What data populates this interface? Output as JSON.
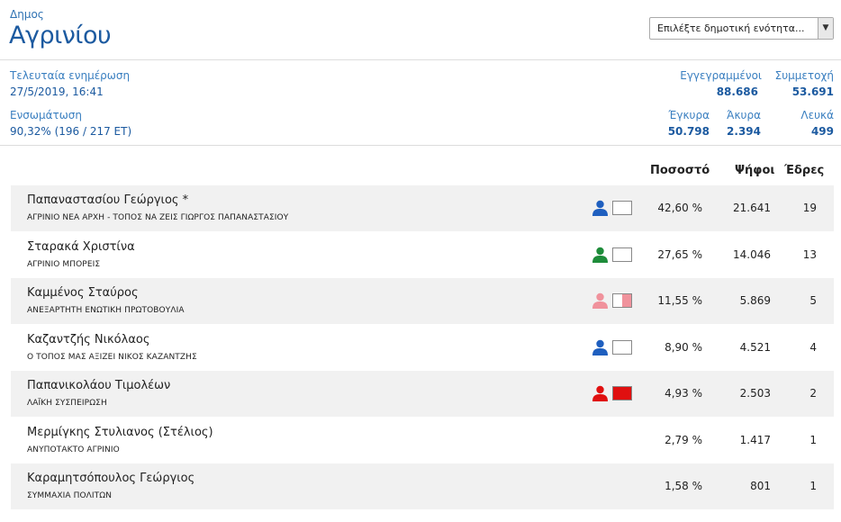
{
  "header": {
    "muni_label": "Δημος",
    "muni_name": "Αγρινίου",
    "select_placeholder": "Επιλέξτε δημοτική ενότητα..."
  },
  "stats": {
    "update_label": "Τελευταία ενημέρωση",
    "update_value": "27/5/2019, 16:41",
    "coverage_label": "Ενσωμάτωση",
    "coverage_value": "90,32% (196 / 217 ΕΤ)",
    "registered_label": "Εγγεγραμμένοι",
    "registered_value": "88.686",
    "turnout_label": "Συμμετοχή",
    "turnout_value": "53.691",
    "valid_label": "Έγκυρα",
    "valid_value": "50.798",
    "invalid_label": "Άκυρα",
    "invalid_value": "2.394",
    "blank_label": "Λευκά",
    "blank_value": "499"
  },
  "table": {
    "col_pct": "Ποσοστό",
    "col_votes": "Ψήφοι",
    "col_seats": "Έδρες",
    "rows": [
      {
        "name": "Παπαναστασίου Γεώργιος *",
        "party": "ΑΓΡΙΝΙΟ ΝΕΑ ΑΡΧΗ - ΤΟΠΟΣ ΝΑ ΖΕΙΣ ΓΙΩΡΓΟΣ ΠΑΠΑΝΑΣΤΑΣΙΟΥ",
        "pct": "42,60 %",
        "votes": "21.641",
        "seats": "19",
        "color": "#1f5fbf",
        "box_fill": 0.0,
        "box_color": "#ffffff",
        "icon": "person-icon"
      },
      {
        "name": "Σταρακά Χριστίνα",
        "party": "ΑΓΡΙΝΙΟ ΜΠΟΡΕΙΣ",
        "pct": "27,65 %",
        "votes": "14.046",
        "seats": "13",
        "color": "#1e8c3a",
        "box_fill": 0.0,
        "box_color": "#ffffff",
        "icon": "person-icon"
      },
      {
        "name": "Καμμένος Σταύρος",
        "party": "ΑΝΕΞΑΡΤΗΤΗ ΕΝΩΤΙΚΗ ΠΡΩΤΟΒΟΥΛΙΑ",
        "pct": "11,55 %",
        "votes": "5.869",
        "seats": "5",
        "color": "#f0929c",
        "box_fill": 0.5,
        "box_color": "#f0929c",
        "icon": "person-icon"
      },
      {
        "name": "Καζαντζής Νικόλαος",
        "party": "Ο ΤΟΠΟΣ ΜΑΣ ΑΞΙΖΕΙ ΝΙΚΟΣ ΚΑΖΑΝΤΖΗΣ",
        "pct": "8,90 %",
        "votes": "4.521",
        "seats": "4",
        "color": "#1f5fbf",
        "box_fill": 0.0,
        "box_color": "#ffffff",
        "icon": "person-icon"
      },
      {
        "name": "Παπανικολάου Τιμολέων",
        "party": "ΛΑΪΚΗ ΣΥΣΠΕΙΡΩΣΗ",
        "pct": "4,93 %",
        "votes": "2.503",
        "seats": "2",
        "color": "#e01010",
        "box_fill": 1.0,
        "box_color": "#e01010",
        "icon": "person-icon"
      },
      {
        "name": "Μερμίγκης Στυλιανος (Στέλιος)",
        "party": "ΑΝΥΠΟΤΑΚΤΟ ΑΓΡΙΝΙΟ",
        "pct": "2,79 %",
        "votes": "1.417",
        "seats": "1"
      },
      {
        "name": "Καραμητσόπουλος Γεώργιος",
        "party": "ΣΥΜΜΑΧΙΑ ΠΟΛΙΤΩΝ",
        "pct": "1,58 %",
        "votes": "801",
        "seats": "1"
      }
    ]
  }
}
